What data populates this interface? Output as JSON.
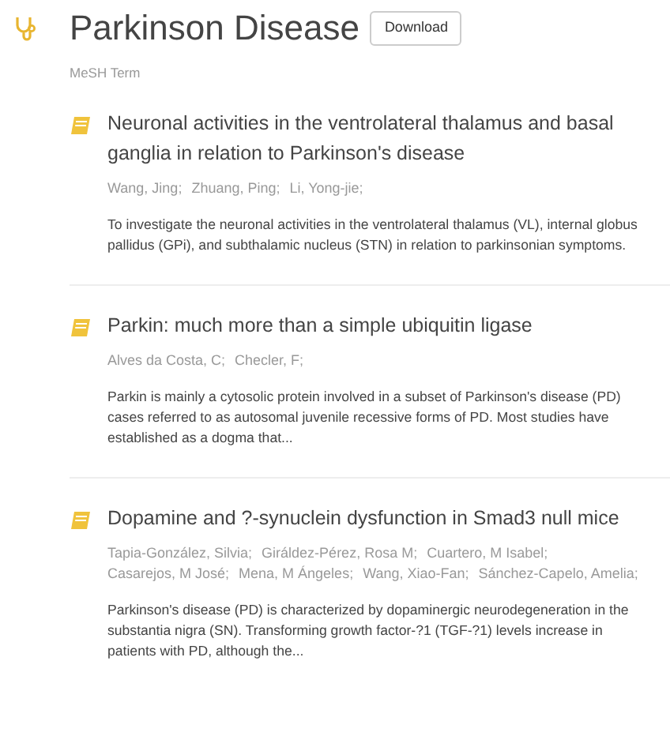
{
  "header": {
    "title": "Parkinson Disease",
    "button": "Download",
    "subtitle": "MeSH Term"
  },
  "articles": [
    {
      "title": "Neuronal activities in the ventrolateral thalamus and basal ganglia in relation to Parkinson's disease",
      "authors": [
        "Wang, Jing;",
        "Zhuang, Ping;",
        "Li, Yong-jie;"
      ],
      "abstract": "To investigate the neuronal activities in the ventrolateral thalamus (VL), internal globus pallidus (GPi), and subthalamic nucleus (STN) in relation to parkinsonian symptoms."
    },
    {
      "title": "Parkin: much more than a simple ubiquitin ligase",
      "authors": [
        "Alves da Costa, C;",
        "Checler, F;"
      ],
      "abstract": "Parkin is mainly a cytosolic protein involved in a subset of Parkinson's disease (PD) cases referred to as autosomal juvenile recessive forms of PD. Most studies have established as a dogma that..."
    },
    {
      "title": "Dopamine and ?-synuclein dysfunction in Smad3 null mice",
      "authors": [
        "Tapia-González, Silvia;",
        "Giráldez-Pérez, Rosa M;",
        "Cuartero, M Isabel;",
        "Casarejos, M José;",
        "Mena, M Ángeles;",
        "Wang, Xiao-Fan;",
        "Sánchez-Capelo, Amelia;"
      ],
      "abstract": "Parkinson's disease (PD) is characterized by dopaminergic neurodegeneration in the substantia nigra (SN). Transforming growth factor-?1 (TGF-?1) levels increase in patients with PD, although the..."
    }
  ]
}
